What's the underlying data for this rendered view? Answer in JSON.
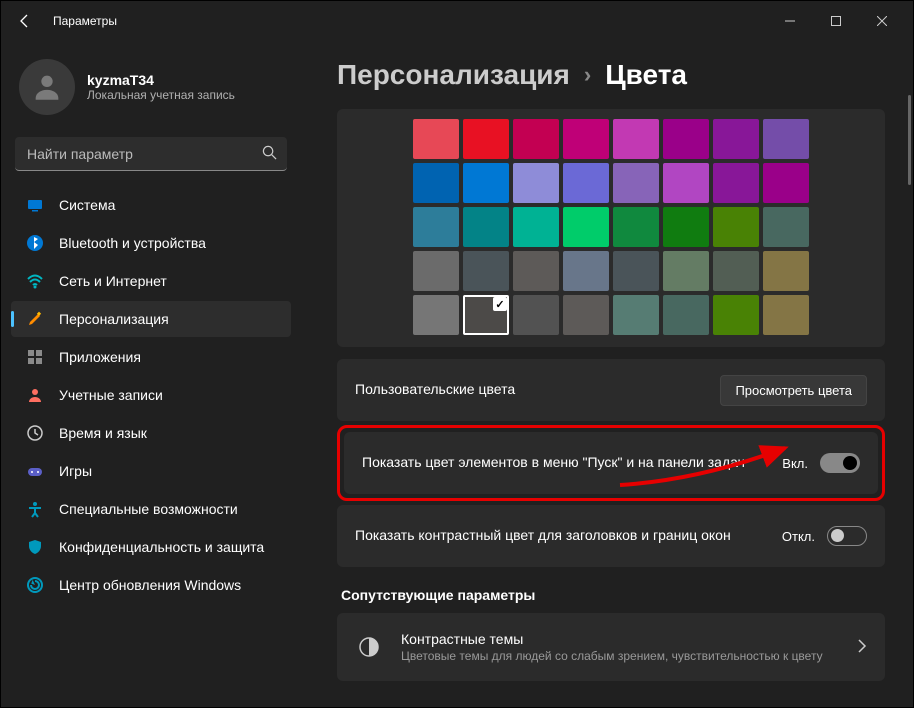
{
  "window_title": "Параметры",
  "user": {
    "name": "kyzmaT34",
    "account": "Локальная учетная запись"
  },
  "search": {
    "placeholder": "Найти параметр"
  },
  "nav": [
    {
      "label": "Система",
      "color": "#0078d4",
      "icon": "system"
    },
    {
      "label": "Bluetooth и устройства",
      "color": "#0078d4",
      "icon": "bluetooth"
    },
    {
      "label": "Сеть и Интернет",
      "color": "#00b7c3",
      "icon": "wifi"
    },
    {
      "label": "Персонализация",
      "color": "#ff8c00",
      "icon": "brush",
      "active": true
    },
    {
      "label": "Приложения",
      "color": "#8a8a8a",
      "icon": "apps"
    },
    {
      "label": "Учетные записи",
      "color": "#ff6f61",
      "icon": "account"
    },
    {
      "label": "Время и язык",
      "color": "#8a8a8a",
      "icon": "time"
    },
    {
      "label": "Игры",
      "color": "#5b5fc7",
      "icon": "games"
    },
    {
      "label": "Специальные возможности",
      "color": "#0099bc",
      "icon": "accessibility"
    },
    {
      "label": "Конфиденциальность и защита",
      "color": "#0099bc",
      "icon": "privacy"
    },
    {
      "label": "Центр обновления Windows",
      "color": "#0099bc",
      "icon": "update"
    }
  ],
  "breadcrumb": {
    "parent": "Персонализация",
    "sep": "›",
    "current": "Цвета"
  },
  "colors_row0": [
    "#e74856",
    "#e81123",
    "#c30052",
    "#bf0077",
    "#c239b3",
    "#9a0089",
    "#881798",
    "#744da9"
  ],
  "colors_row1": [
    "#0063b1",
    "#0078d4",
    "#8e8cd8",
    "#6b69d6",
    "#8764b8",
    "#b146c2",
    "#881798",
    "#9a0089"
  ],
  "colors_row2": [
    "#2d7d9a",
    "#038387",
    "#00b294",
    "#00cc6a",
    "#10893e",
    "#107c10",
    "#498205",
    "#486860"
  ],
  "colors_row3": [
    "#6b6b6b",
    "#4a5459",
    "#5d5a58",
    "#68768a",
    "#4a5459",
    "#647c64",
    "#525e54",
    "#847545"
  ],
  "colors_row4": [
    "#767676",
    "#4c4a48",
    "#525252",
    "#5d5a58",
    "#567c73",
    "#486860",
    "#498205",
    "#847545"
  ],
  "selected_color_index": {
    "row": 4,
    "col": 1
  },
  "custom_colors": {
    "label": "Пользовательские цвета",
    "button": "Просмотреть цвета"
  },
  "accent_start": {
    "label": "Показать цвет элементов в меню \"Пуск\" и на панели задач",
    "state_label": "Вкл.",
    "on": true
  },
  "accent_title": {
    "label": "Показать контрастный цвет для заголовков и границ окон",
    "state_label": "Откл.",
    "on": false
  },
  "related": {
    "header": "Сопутствующие параметры",
    "contrast_title": "Контрастные темы",
    "contrast_sub": "Цветовые темы для людей со слабым зрением, чувствительностью к цвету"
  }
}
